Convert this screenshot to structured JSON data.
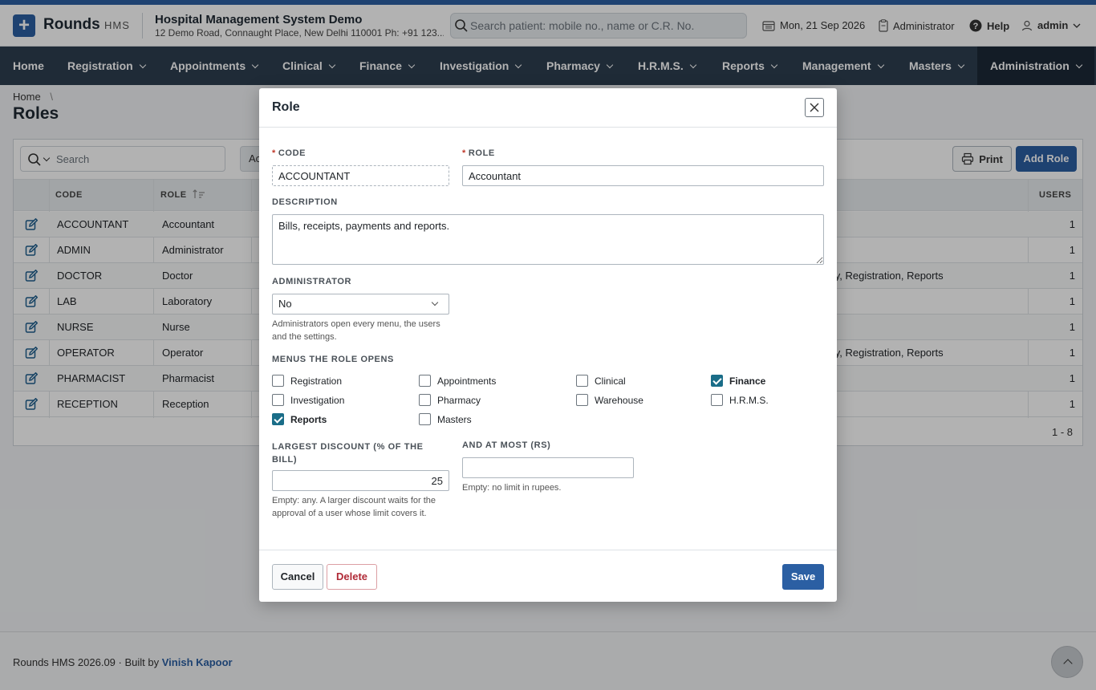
{
  "header": {
    "logo_glyph": "+",
    "brand": "Rounds",
    "brand_sub": "HMS",
    "hospital_name": "Hospital Management System Demo",
    "hospital_address": "12 Demo Road, Connaught Place, New Delhi 110001 Ph: +91 123...",
    "search_placeholder": "Search patient: mobile no., name or C.R. No.",
    "date": "Mon, 21 Sep 2026",
    "role": "Administrator",
    "help": "Help",
    "user": "admin"
  },
  "nav": {
    "items": [
      {
        "label": "Home"
      },
      {
        "label": "Registration"
      },
      {
        "label": "Appointments"
      },
      {
        "label": "Clinical"
      },
      {
        "label": "Finance"
      },
      {
        "label": "Investigation"
      },
      {
        "label": "Pharmacy"
      },
      {
        "label": "H.R.M.S."
      },
      {
        "label": "Reports"
      },
      {
        "label": "Management"
      },
      {
        "label": "Masters"
      },
      {
        "label": "Administration"
      }
    ],
    "active": "Administration"
  },
  "breadcrumb": {
    "home": "Home",
    "sep": "\\"
  },
  "page": {
    "title": "Roles"
  },
  "toolbar": {
    "search_placeholder": "Search",
    "partial_button": "Ac",
    "print": "Print",
    "add": "Add Role"
  },
  "table": {
    "headers": {
      "code": "CODE",
      "role": "ROLE",
      "users": "USERS"
    },
    "rows": [
      {
        "code": "ACCOUNTANT",
        "role": "Accountant",
        "menus": "",
        "users": "1"
      },
      {
        "code": "ADMIN",
        "role": "Administrator",
        "menus": "",
        "users": "1"
      },
      {
        "code": "DOCTOR",
        "role": "Doctor",
        "menus": "acy, Registration, Reports",
        "users": "1"
      },
      {
        "code": "LAB",
        "role": "Laboratory",
        "menus": "",
        "users": "1"
      },
      {
        "code": "NURSE",
        "role": "Nurse",
        "menus": "",
        "users": "1"
      },
      {
        "code": "OPERATOR",
        "role": "Operator",
        "menus": "acy, Registration, Reports",
        "users": "1"
      },
      {
        "code": "PHARMACIST",
        "role": "Pharmacist",
        "menus": "",
        "users": "1"
      },
      {
        "code": "RECEPTION",
        "role": "Reception",
        "menus": "",
        "users": "1"
      }
    ],
    "pager": "1 - 8"
  },
  "modal": {
    "title": "Role",
    "code_label": "CODE",
    "code_value": "ACCOUNTANT",
    "role_label": "ROLE",
    "role_value": "Accountant",
    "description_label": "DESCRIPTION",
    "description_value": "Bills, receipts, payments and reports.",
    "admin_label": "ADMINISTRATOR",
    "admin_value": "No",
    "admin_help": "Administrators open every menu, the users and the settings.",
    "menus_label": "MENUS THE ROLE OPENS",
    "menus": [
      {
        "label": "Registration",
        "checked": false
      },
      {
        "label": "Appointments",
        "checked": false
      },
      {
        "label": "Clinical",
        "checked": false
      },
      {
        "label": "Finance",
        "checked": true
      },
      {
        "label": "Investigation",
        "checked": false
      },
      {
        "label": "Pharmacy",
        "checked": false
      },
      {
        "label": "Warehouse",
        "checked": false
      },
      {
        "label": "H.R.M.S.",
        "checked": false
      },
      {
        "label": "Reports",
        "checked": true
      },
      {
        "label": "Masters",
        "checked": false
      }
    ],
    "discount_label": "LARGEST DISCOUNT (% OF THE BILL)",
    "discount_value": "25",
    "discount_help": "Empty: any. A larger discount waits for the approval of a user whose limit covers it.",
    "atmost_label": "AND AT MOST (RS)",
    "atmost_value": "",
    "atmost_help": "Empty: no limit in rupees.",
    "cancel": "Cancel",
    "delete": "Delete",
    "save": "Save"
  },
  "footer": {
    "text": "Rounds HMS 2026.09 · Built by",
    "author": "Vinish Kapoor"
  },
  "colors": {
    "brand": "#2b5fa3",
    "nav_bg": "#2d3e50",
    "nav_active": "#1c2937",
    "checkbox_on": "#1a6d88",
    "danger": "#b02a37"
  }
}
